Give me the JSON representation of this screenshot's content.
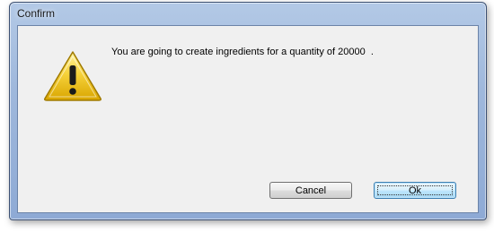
{
  "window": {
    "title": "Confirm"
  },
  "dialog": {
    "icon": "warning-icon",
    "message": "You are going to create ingredients for a quantity of 20000  .",
    "buttons": {
      "cancel_label": "Cancel",
      "ok_label": "Ok"
    }
  },
  "colors": {
    "frame": "#9fb8dc",
    "client_background": "#f0f0f0",
    "warning_yellow": "#f2c400",
    "ok_button_border": "#3c7fb1"
  }
}
